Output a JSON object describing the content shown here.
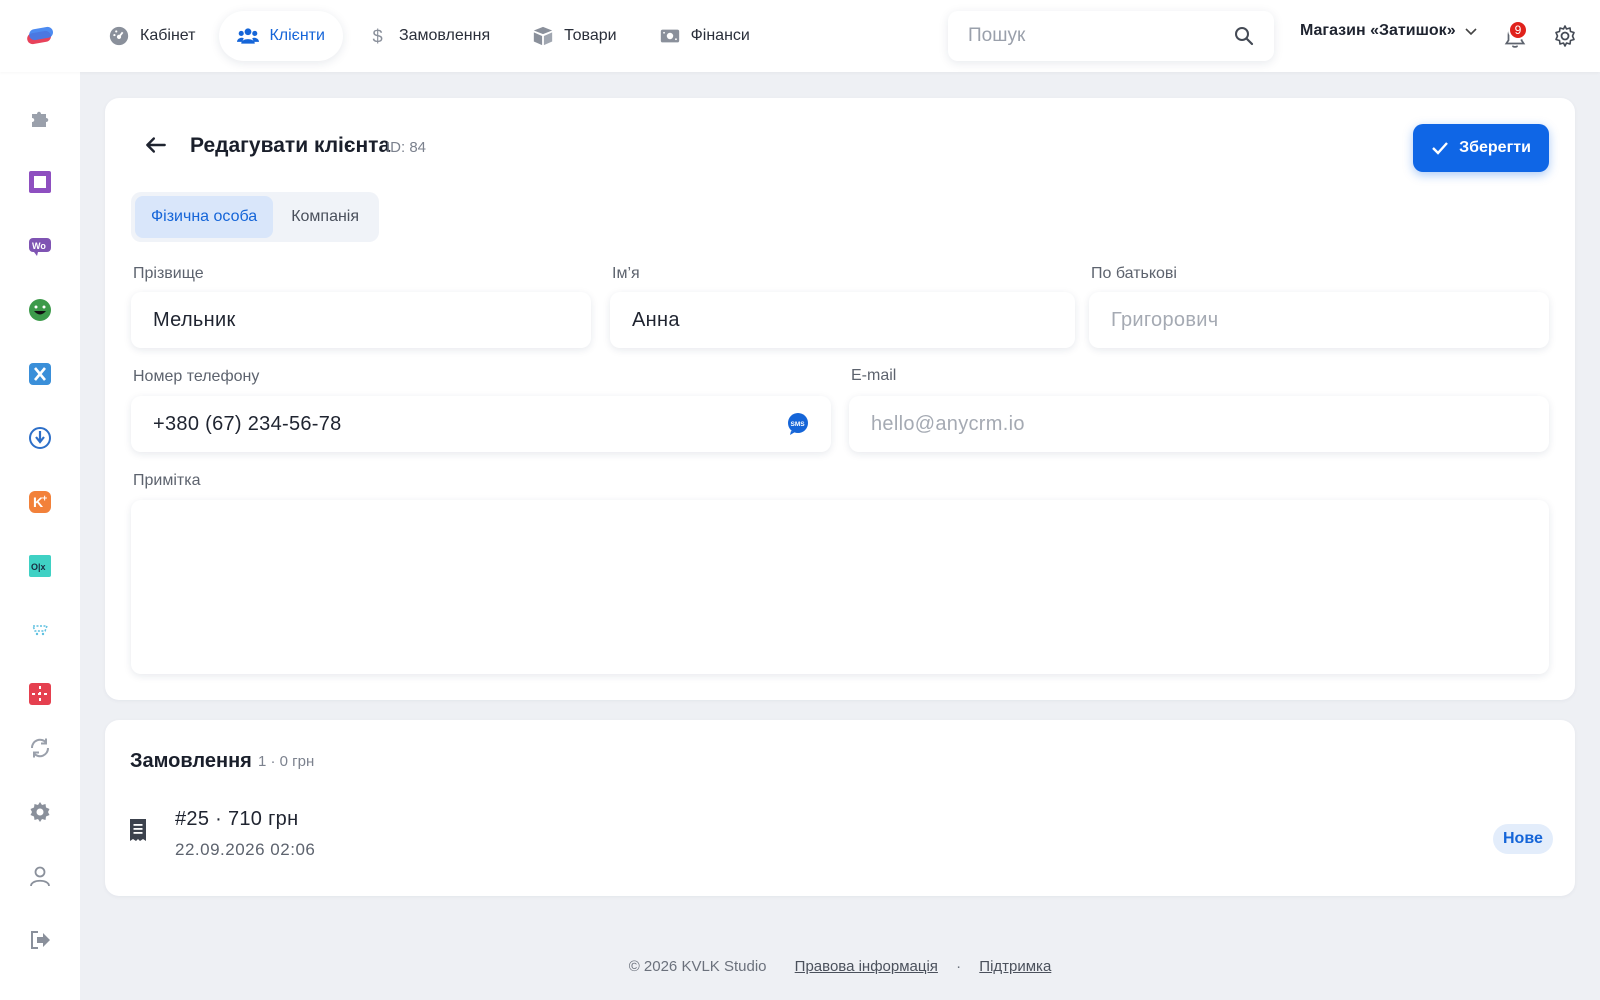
{
  "nav": {
    "items": [
      {
        "label": "Кабінет",
        "icon": "dashboard-icon"
      },
      {
        "label": "Клієнти",
        "icon": "users-icon",
        "active": true
      },
      {
        "label": "Замовлення",
        "icon": "dollar-icon"
      },
      {
        "label": "Товари",
        "icon": "box-icon"
      },
      {
        "label": "Фінанси",
        "icon": "money-icon"
      }
    ]
  },
  "search": {
    "placeholder": "Пошук"
  },
  "store": {
    "name": "Магазин «Затишок»"
  },
  "notifications": {
    "count": "9"
  },
  "sidebar": {
    "icons": [
      "puzzle-icon",
      "square-icon",
      "woo-icon",
      "emoji-icon",
      "x-app-icon",
      "download-pin-icon",
      "k-plus-icon",
      "olx-icon",
      "cart-icon",
      "grid-app-icon",
      "sync-icon",
      "settings-icon",
      "user-icon",
      "logout-icon"
    ]
  },
  "form": {
    "title": "Редагувати клієнта",
    "id_label": "ID: 84",
    "save_label": "Зберегти",
    "tabs": [
      "Фізична особа",
      "Компанія"
    ],
    "active_tab": "Фізична особа",
    "last_name": {
      "label": "Прізвище",
      "value": "Мельник",
      "placeholder": ""
    },
    "first_name": {
      "label": "Ім’я",
      "value": "Анна",
      "placeholder": ""
    },
    "middle_name": {
      "label": "По батькові",
      "value": "",
      "placeholder": "Григорович"
    },
    "phone": {
      "label": "Номер телефону",
      "value": "+380 (67) 234-56-78",
      "placeholder": ""
    },
    "email": {
      "label": "E-mail",
      "value": "",
      "placeholder": "hello@anycrm.io"
    },
    "note": {
      "label": "Примітка",
      "value": "",
      "placeholder": ""
    }
  },
  "orders": {
    "title": "Замовлення",
    "meta": "1 · 0 грн",
    "items": [
      {
        "number": "#25 · 710 грн",
        "date": "22.09.2026 02:06",
        "status": "Нове"
      }
    ]
  },
  "footer": {
    "copyright": "© 2026 KVLK Studio",
    "legal": "Правова інформація",
    "separator": "·",
    "support": "Підтримка"
  },
  "colors": {
    "accent": "#0f66e6",
    "badge": "#e0221c",
    "background": "#eef0f4"
  }
}
